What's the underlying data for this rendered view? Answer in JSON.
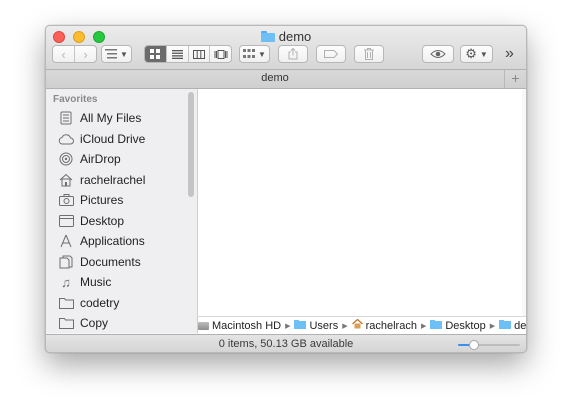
{
  "window": {
    "title": "demo"
  },
  "toolbar": {
    "back_icon": "chevron-left-icon",
    "forward_icon": "chevron-right-icon",
    "more_label": "»"
  },
  "tab": {
    "label": "demo",
    "add_label": "+"
  },
  "sidebar": {
    "heading": "Favorites",
    "items": [
      {
        "label": "All My Files",
        "icon": "all-files-icon"
      },
      {
        "label": "iCloud Drive",
        "icon": "cloud-icon"
      },
      {
        "label": "AirDrop",
        "icon": "airdrop-icon"
      },
      {
        "label": "rachelrachel",
        "icon": "home-icon"
      },
      {
        "label": "Pictures",
        "icon": "camera-icon"
      },
      {
        "label": "Desktop",
        "icon": "desktop-icon"
      },
      {
        "label": "Applications",
        "icon": "applications-icon"
      },
      {
        "label": "Documents",
        "icon": "documents-icon"
      },
      {
        "label": "Music",
        "icon": "music-icon"
      },
      {
        "label": "codetry",
        "icon": "folder-icon"
      },
      {
        "label": "Copy",
        "icon": "folder-icon"
      }
    ]
  },
  "pathbar": {
    "items": [
      {
        "label": "Macintosh HD",
        "icon": "hard-drive-icon"
      },
      {
        "label": "Users",
        "icon": "folder-icon"
      },
      {
        "label": "rachelrach",
        "icon": "home-icon"
      },
      {
        "label": "Desktop",
        "icon": "folder-icon"
      },
      {
        "label": "demo",
        "icon": "folder-icon"
      }
    ]
  },
  "status": {
    "text": "0 items, 50.13 GB available",
    "icon_size_level": 0.25
  },
  "colors": {
    "accent": "#3b8df0",
    "folder": "#6cc0f6"
  }
}
